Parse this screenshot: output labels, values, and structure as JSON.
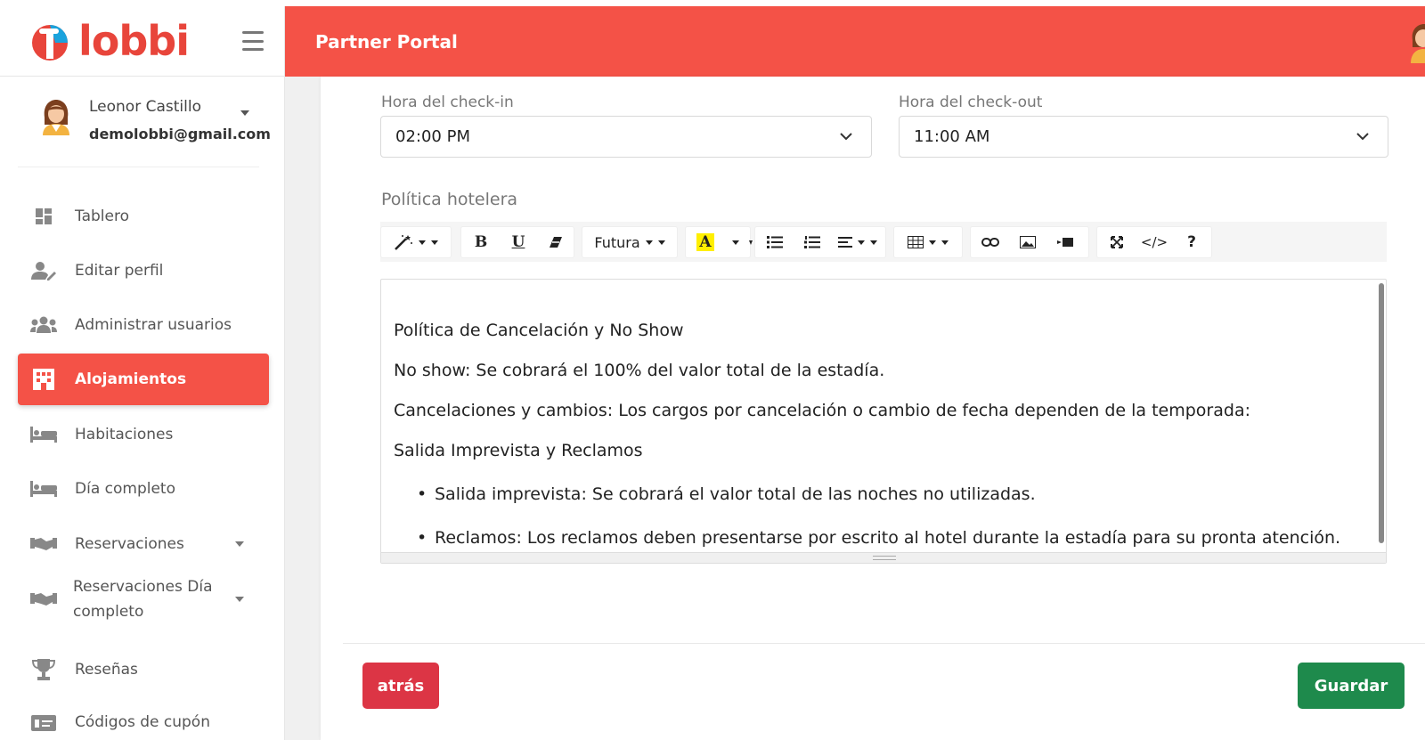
{
  "brand": {
    "name": "lobbi"
  },
  "header": {
    "title": "Partner Portal"
  },
  "user": {
    "name": "Leonor Castillo",
    "email": "demolobbi@gmail.com"
  },
  "sidebar": {
    "items": [
      {
        "label": "Tablero",
        "icon": "dashboard-icon"
      },
      {
        "label": "Editar perfil",
        "icon": "user-edit-icon"
      },
      {
        "label": "Administrar usuarios",
        "icon": "users-icon"
      },
      {
        "label": "Alojamientos",
        "icon": "building-icon",
        "active": true
      },
      {
        "label": "Habitaciones",
        "icon": "bed-icon"
      },
      {
        "label": "Día completo",
        "icon": "bed-icon"
      },
      {
        "label": "Reservaciones",
        "icon": "handshake-icon"
      },
      {
        "label": "Reservaciones Día",
        "label2": "completo",
        "icon": "handshake-icon"
      },
      {
        "label": "Reseñas",
        "icon": "trophy-icon"
      },
      {
        "label": "Códigos de cupón",
        "icon": "coupon-icon"
      }
    ]
  },
  "form": {
    "checkin": {
      "label": "Hora del check-in",
      "value": "02:00 PM"
    },
    "checkout": {
      "label": "Hora del check-out",
      "value": "11:00 AM"
    },
    "policy_label": "Política hotelera"
  },
  "toolbar": {
    "font": "Futura",
    "bold": "B",
    "underline": "U",
    "color_letter": "A",
    "code": "</>",
    "help": "?"
  },
  "editor": {
    "lines": [
      "Política de Cancelación y No Show",
      "No show: Se cobrará el 100% del valor total de la estadía.",
      "Cancelaciones y cambios: Los cargos por cancelación o cambio de fecha dependen de la temporada:",
      "Salida Imprevista y Reclamos"
    ],
    "bullets": [
      "Salida imprevista: Se cobrará el valor total de las noches no utilizadas.",
      "Reclamos: Los reclamos deben presentarse por escrito al hotel durante la estadía para su pronta atención."
    ]
  },
  "actions": {
    "back": "atrás",
    "save": "Guardar"
  },
  "colors": {
    "accent": "#f45247",
    "back": "#dc3545",
    "save": "#1e8a4c"
  }
}
